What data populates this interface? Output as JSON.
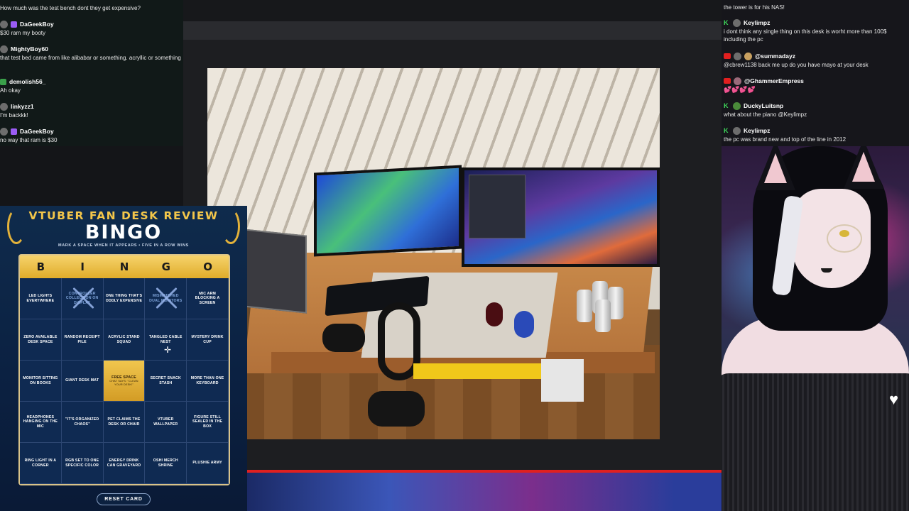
{
  "chat_left": {
    "messages": [
      {
        "user": "",
        "text": "How much was the test bench dont they get expensive?"
      },
      {
        "user": "DaGeekBoy",
        "text": "$30 ram my booty"
      },
      {
        "user": "MightyBoy60",
        "text": "that test bed came from like alibabar or something. acryllic or something"
      },
      {
        "user": "demolish56_",
        "text": "Ah okay"
      },
      {
        "user": "linkyzz1",
        "text": "I'm backkk!"
      },
      {
        "user": "DaGeekBoy",
        "text": "no way that ram is $30"
      }
    ]
  },
  "chat_right": {
    "top_text": "the tower is for his NAS!",
    "messages": [
      {
        "user": "Keylimpz",
        "platform": "kick",
        "text": "i dont think any single thing on this desk is worht more than 100$ including the pc"
      },
      {
        "user": "@summadayz",
        "platform": "youtube",
        "text": "@cbrew1138 back me up do you have mayo at your desk"
      },
      {
        "user": "@GhammerEmpress",
        "platform": "youtube",
        "text": "💕💕💕💕"
      },
      {
        "user": "DuckyLuitsnp",
        "platform": "kick",
        "text": "what about the piano @Keylimpz"
      },
      {
        "user": "Keylimpz",
        "platform": "kick",
        "text": "the pc was brand new and top of the line in 2012"
      }
    ]
  },
  "bingo": {
    "title": "VTUBER FAN DESK REVIEW",
    "big": "BINGO",
    "subtitle": "MARK A SPACE WHEN IT APPEARS • FIVE IN A ROW WINS",
    "letters": [
      "B",
      "I",
      "N",
      "G",
      "O"
    ],
    "cells": [
      {
        "text": "LED LIGHTS EVERYWHERE",
        "marked": false
      },
      {
        "text": "CONTROLLER COLLECTION ON DISPLAY",
        "marked": true
      },
      {
        "text": "ONE THING THAT'S ODDLY EXPENSIVE",
        "marked": false
      },
      {
        "text": "MISMATCHED DUAL MONITORS",
        "marked": true
      },
      {
        "text": "MIC ARM BLOCKING A SCREEN",
        "marked": false
      },
      {
        "text": "ZERO AVAILABLE DESK SPACE",
        "marked": false
      },
      {
        "text": "RANDOM RECEIPT PILE",
        "marked": false
      },
      {
        "text": "ACRYLIC STAND SQUAD",
        "marked": false
      },
      {
        "text": "TANGLED CABLE NEST",
        "marked": false
      },
      {
        "text": "MYSTERY DRINK CUP",
        "marked": false
      },
      {
        "text": "MONITOR SITTING ON BOOKS",
        "marked": false
      },
      {
        "text": "GIANT DESK MAT",
        "marked": false
      },
      {
        "text": "FREE SPACE",
        "sub": "CHAT SAYS: \"CLEAN YOUR DESK!\"",
        "free": true,
        "marked": false
      },
      {
        "text": "SECRET SNACK STASH",
        "marked": false
      },
      {
        "text": "MORE THAN ONE KEYBOARD",
        "marked": false
      },
      {
        "text": "HEADPHONES HANGING ON THE MIC",
        "marked": false
      },
      {
        "text": "\"IT'S ORGANIZED CHAOS\"",
        "marked": false
      },
      {
        "text": "PET CLAIMS THE DESK OR CHAIR",
        "marked": false
      },
      {
        "text": "VTUBER WALLPAPER",
        "marked": false
      },
      {
        "text": "FIGURE STILL SEALED IN THE BOX",
        "marked": false
      },
      {
        "text": "RING LIGHT IN A CORNER",
        "marked": false
      },
      {
        "text": "RGB SET TO ONE SPECIFIC COLOR",
        "marked": false
      },
      {
        "text": "ENERGY DRINK CAN GRAVEYARD",
        "marked": false
      },
      {
        "text": "OSHI MERCH SHRINE",
        "marked": false
      },
      {
        "text": "PLUSHIE ARMY",
        "marked": false
      }
    ],
    "reset_label": "RESET CARD"
  },
  "colors": {
    "accent_gold": "#f3c64a",
    "bingo_bg": "#0f2b4c",
    "kick_green": "#3ed85a",
    "youtube_red": "#e21f1f",
    "badge_purple": "#9b5cf5"
  }
}
